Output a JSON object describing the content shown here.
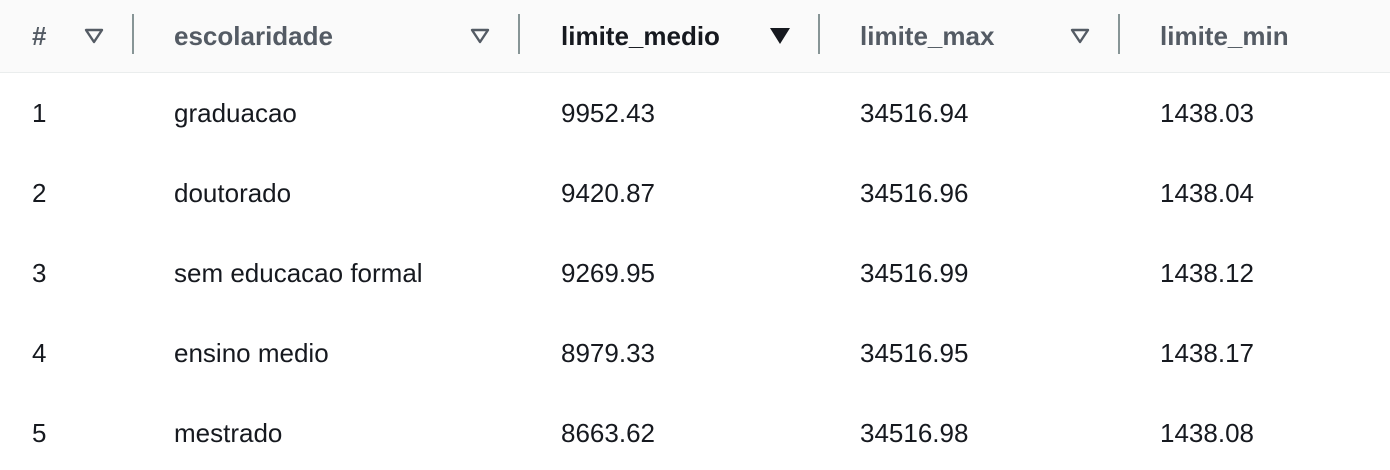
{
  "table": {
    "columns": [
      {
        "key": "idx",
        "label": "#",
        "sort": "none"
      },
      {
        "key": "escolaridade",
        "label": "escolaridade",
        "sort": "none"
      },
      {
        "key": "limite_medio",
        "label": "limite_medio",
        "sort": "descending"
      },
      {
        "key": "limite_max",
        "label": "limite_max",
        "sort": "none"
      },
      {
        "key": "limite_min",
        "label": "limite_min",
        "sort": "none"
      }
    ],
    "rows": [
      {
        "idx": "1",
        "escolaridade": "graduacao",
        "limite_medio": "9952.43",
        "limite_max": "34516.94",
        "limite_min": "1438.03"
      },
      {
        "idx": "2",
        "escolaridade": "doutorado",
        "limite_medio": "9420.87",
        "limite_max": "34516.96",
        "limite_min": "1438.04"
      },
      {
        "idx": "3",
        "escolaridade": "sem educacao formal",
        "limite_medio": "9269.95",
        "limite_max": "34516.99",
        "limite_min": "1438.12"
      },
      {
        "idx": "4",
        "escolaridade": "ensino medio",
        "limite_medio": "8979.33",
        "limite_max": "34516.95",
        "limite_min": "1438.17"
      },
      {
        "idx": "5",
        "escolaridade": "mestrado",
        "limite_medio": "8663.62",
        "limite_max": "34516.98",
        "limite_min": "1438.08"
      }
    ]
  },
  "colors": {
    "header_bg": "#fafafa",
    "header_text": "#545b64",
    "sorted_header_text": "#16191f",
    "row_border": "#eaeded",
    "divider": "#879596"
  },
  "icons": {
    "sort_none": "caret-down-outline-icon",
    "sort_descending": "caret-down-filled-icon"
  }
}
